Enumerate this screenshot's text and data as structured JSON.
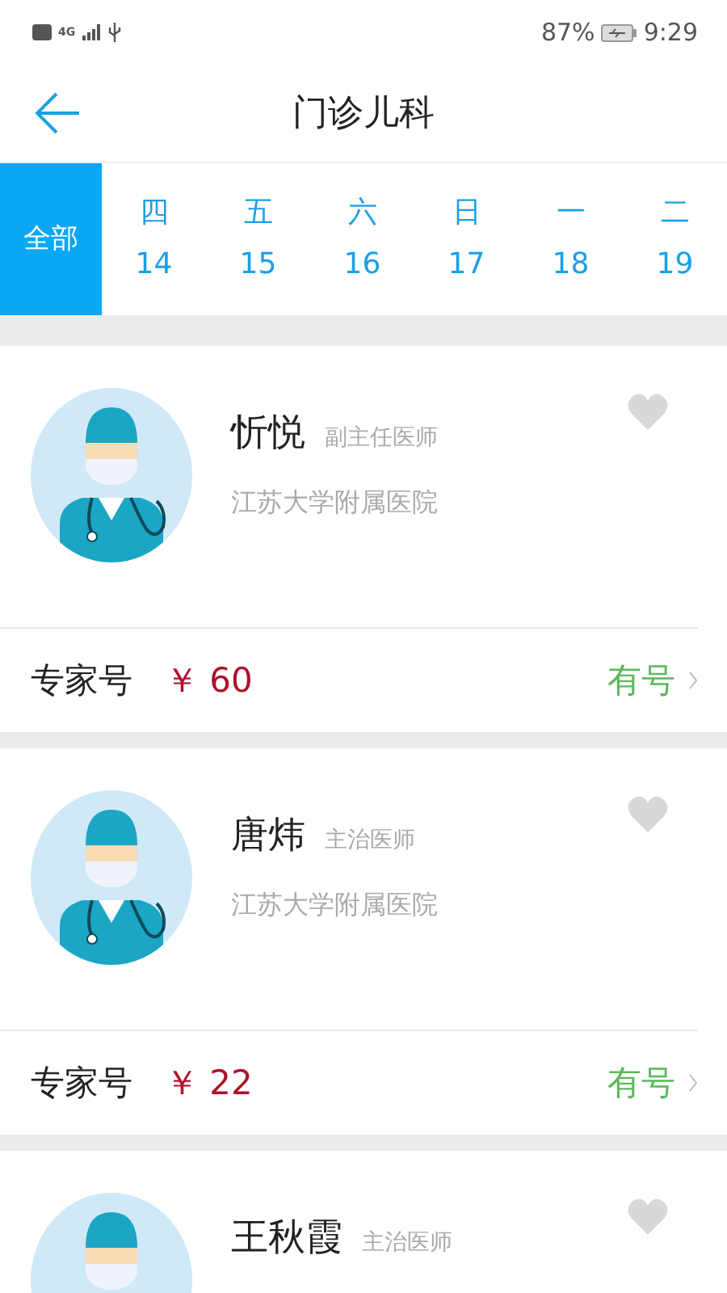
{
  "status_bar": {
    "network": "4G",
    "battery": "87%",
    "time": "9:29"
  },
  "header": {
    "title": "门诊儿科"
  },
  "date_tabs": [
    {
      "kind": "all",
      "label": "全部",
      "selected": true
    },
    {
      "kind": "day",
      "weekday": "四",
      "date": "14",
      "selected": false
    },
    {
      "kind": "day",
      "weekday": "五",
      "date": "15",
      "selected": false
    },
    {
      "kind": "day",
      "weekday": "六",
      "date": "16",
      "selected": false
    },
    {
      "kind": "day",
      "weekday": "日",
      "date": "17",
      "selected": false
    },
    {
      "kind": "day",
      "weekday": "一",
      "date": "18",
      "selected": false
    },
    {
      "kind": "day",
      "weekday": "二",
      "date": "19",
      "selected": false
    }
  ],
  "doctors": [
    {
      "name": "忻悦",
      "title": "副主任医师",
      "hospital": "江苏大学附属医院",
      "favorited": false,
      "type": "专家号",
      "price": "￥ 60",
      "availability": "有号"
    },
    {
      "name": "唐炜",
      "title": "主治医师",
      "hospital": "江苏大学附属医院",
      "favorited": false,
      "type": "专家号",
      "price": "￥ 22",
      "availability": "有号"
    },
    {
      "name": "王秋霞",
      "title": "主治医师",
      "favorited": false
    }
  ]
}
